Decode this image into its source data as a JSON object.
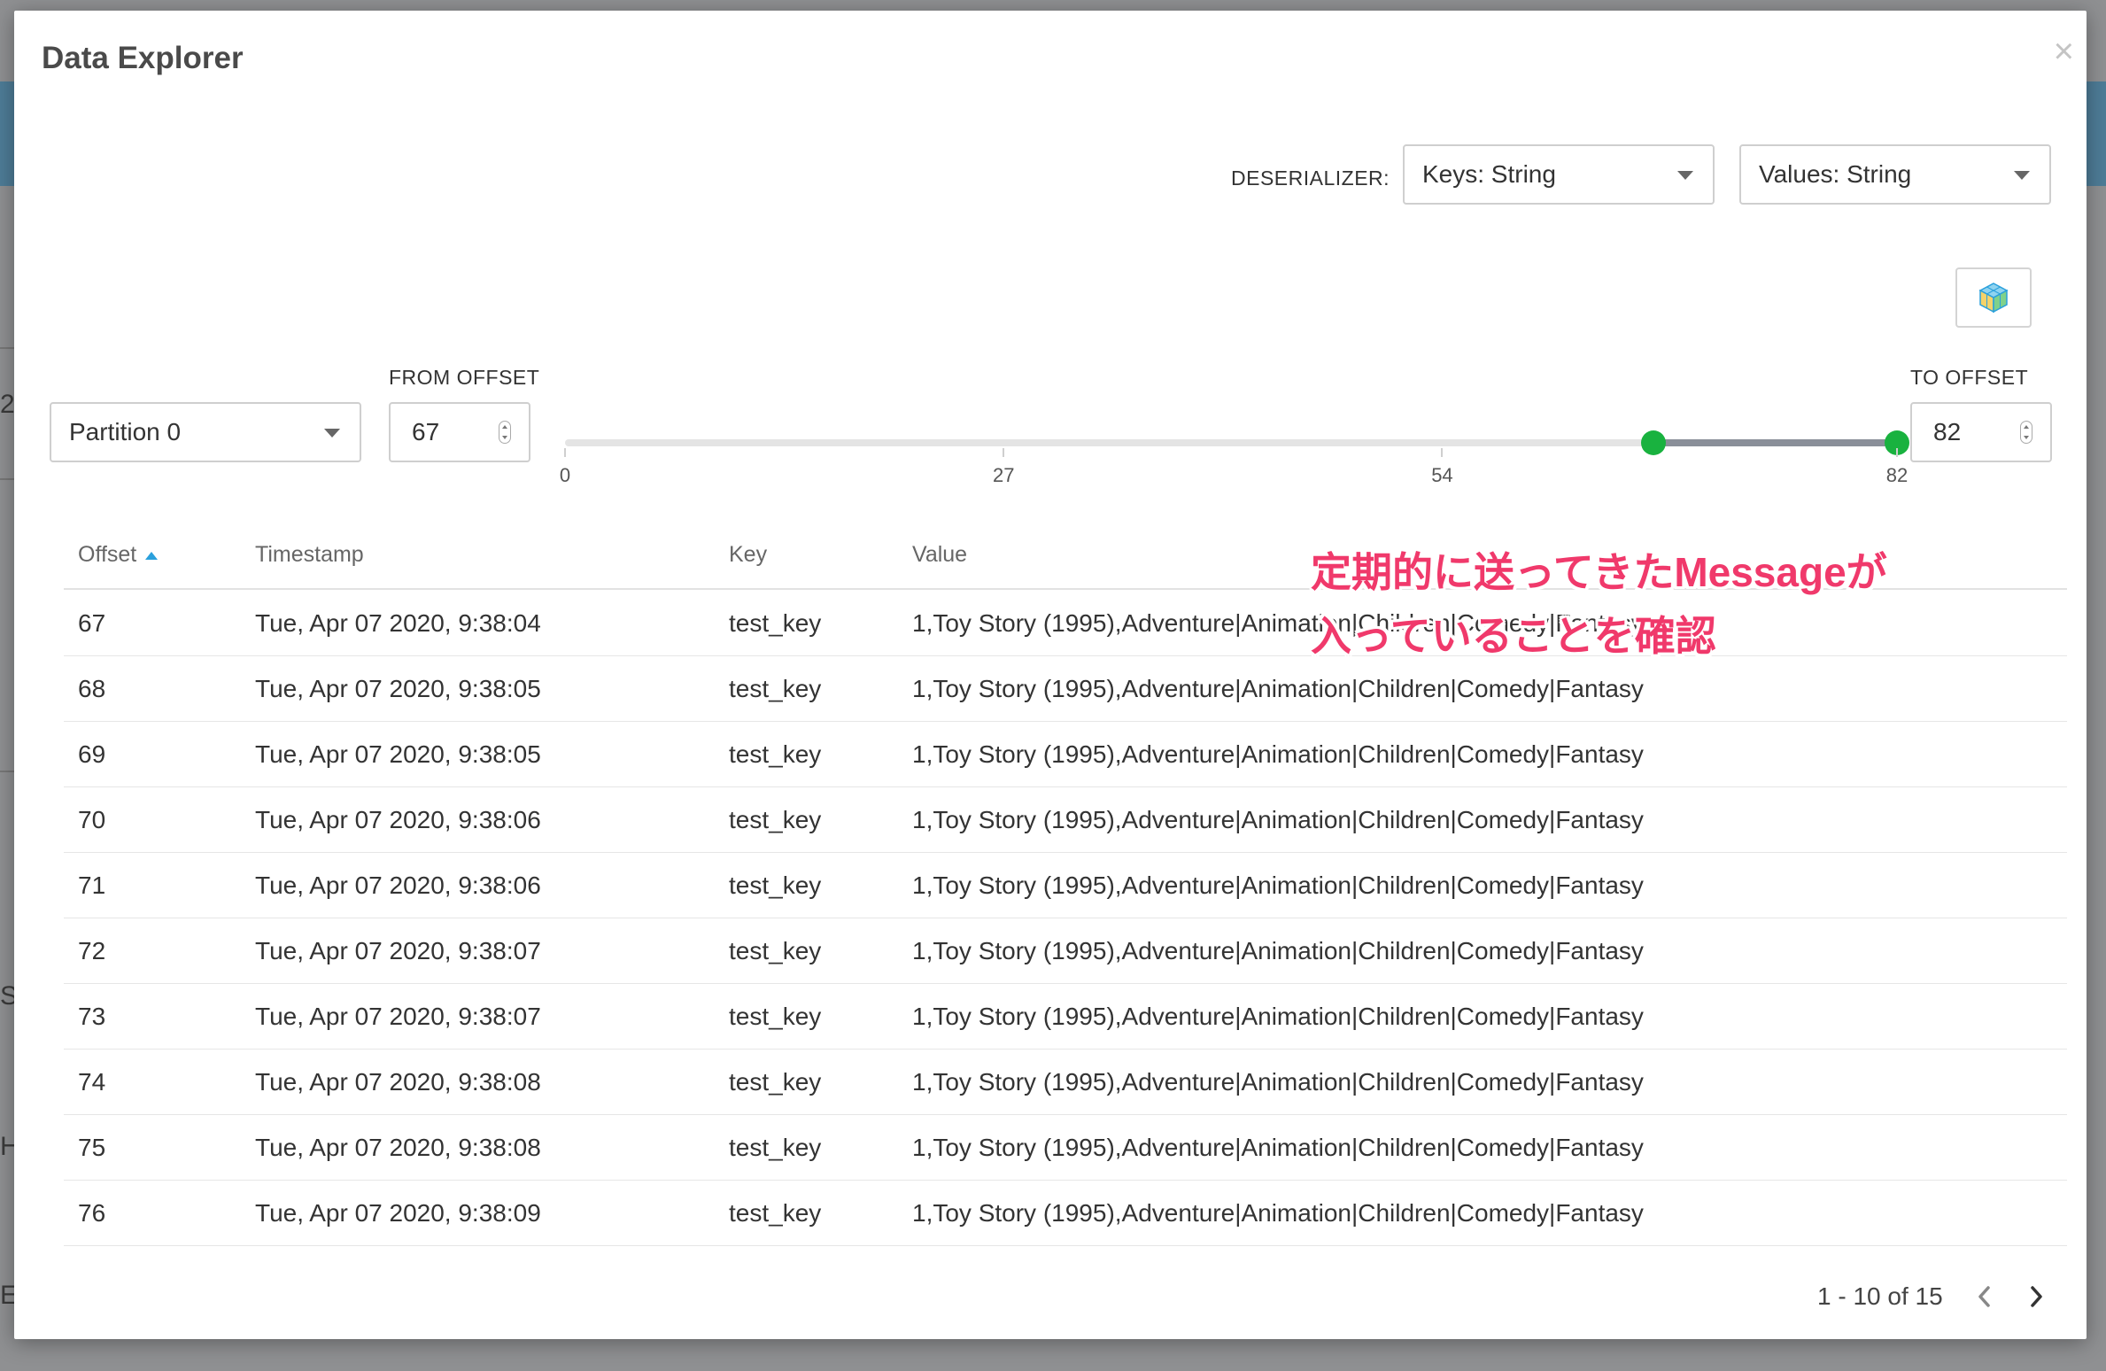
{
  "modal": {
    "title": "Data Explorer",
    "close_label": "×"
  },
  "deserializer": {
    "label": "DESERIALIZER:",
    "keys_value": "Keys: String",
    "values_value": "Values: String"
  },
  "partition": {
    "value": "Partition 0"
  },
  "from_offset": {
    "label": "FROM OFFSET",
    "value": "67"
  },
  "to_offset": {
    "label": "TO OFFSET",
    "value": "82"
  },
  "slider": {
    "min": 0,
    "max": 82,
    "from": 67,
    "to": 82,
    "ticks": [
      "0",
      "27",
      "54",
      "82"
    ]
  },
  "table": {
    "headers": {
      "offset": "Offset",
      "timestamp": "Timestamp",
      "key": "Key",
      "value": "Value"
    },
    "rows": [
      {
        "offset": "67",
        "timestamp": "Tue, Apr 07 2020, 9:38:04",
        "key": "test_key",
        "value": "1,Toy Story (1995),Adventure|Animation|Children|Comedy|Fantasy"
      },
      {
        "offset": "68",
        "timestamp": "Tue, Apr 07 2020, 9:38:05",
        "key": "test_key",
        "value": "1,Toy Story (1995),Adventure|Animation|Children|Comedy|Fantasy"
      },
      {
        "offset": "69",
        "timestamp": "Tue, Apr 07 2020, 9:38:05",
        "key": "test_key",
        "value": "1,Toy Story (1995),Adventure|Animation|Children|Comedy|Fantasy"
      },
      {
        "offset": "70",
        "timestamp": "Tue, Apr 07 2020, 9:38:06",
        "key": "test_key",
        "value": "1,Toy Story (1995),Adventure|Animation|Children|Comedy|Fantasy"
      },
      {
        "offset": "71",
        "timestamp": "Tue, Apr 07 2020, 9:38:06",
        "key": "test_key",
        "value": "1,Toy Story (1995),Adventure|Animation|Children|Comedy|Fantasy"
      },
      {
        "offset": "72",
        "timestamp": "Tue, Apr 07 2020, 9:38:07",
        "key": "test_key",
        "value": "1,Toy Story (1995),Adventure|Animation|Children|Comedy|Fantasy"
      },
      {
        "offset": "73",
        "timestamp": "Tue, Apr 07 2020, 9:38:07",
        "key": "test_key",
        "value": "1,Toy Story (1995),Adventure|Animation|Children|Comedy|Fantasy"
      },
      {
        "offset": "74",
        "timestamp": "Tue, Apr 07 2020, 9:38:08",
        "key": "test_key",
        "value": "1,Toy Story (1995),Adventure|Animation|Children|Comedy|Fantasy"
      },
      {
        "offset": "75",
        "timestamp": "Tue, Apr 07 2020, 9:38:08",
        "key": "test_key",
        "value": "1,Toy Story (1995),Adventure|Animation|Children|Comedy|Fantasy"
      },
      {
        "offset": "76",
        "timestamp": "Tue, Apr 07 2020, 9:38:09",
        "key": "test_key",
        "value": "1,Toy Story (1995),Adventure|Animation|Children|Comedy|Fantasy"
      }
    ]
  },
  "pagination": {
    "text": "1 - 10 of 15"
  },
  "annotation": {
    "line1": "定期的に送ってきたMessageが",
    "line2": "入っていることを確認"
  },
  "background": {
    "edge_letters": [
      "2",
      "S",
      "H",
      "E"
    ]
  },
  "colors": {
    "slider_handle": "#19b23f",
    "sort_arrow": "#2aa0dc",
    "annotation": "#f0396b"
  },
  "icons": {
    "schema": "cube-icon",
    "sort": "sort-ascending-icon",
    "prev": "chevron-left-icon",
    "next": "chevron-right-icon"
  }
}
